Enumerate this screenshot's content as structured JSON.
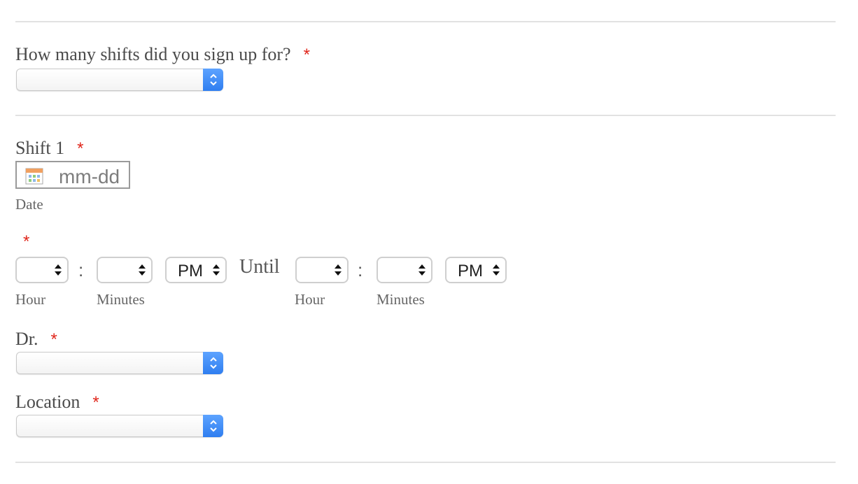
{
  "required_marker": "*",
  "shifts_question": {
    "label": "How many shifts did you sign up for?",
    "value": ""
  },
  "shift1": {
    "label": "Shift 1",
    "date_placeholder": "mm-dd",
    "date_sublabel": "Date",
    "time": {
      "start_hour": "",
      "start_minutes": "",
      "start_ampm": "PM",
      "separator": ":",
      "until_label": "Until",
      "end_hour": "",
      "end_minutes": "",
      "end_ampm": "PM",
      "hour_label": "Hour",
      "minutes_label": "Minutes"
    }
  },
  "doctor": {
    "label": "Dr.",
    "value": ""
  },
  "location": {
    "label": "Location",
    "value": ""
  },
  "icons": {
    "calendar": "calendar-icon",
    "stepper": "updown-chevron-icon",
    "select_arrows": "sort-arrows-icon"
  },
  "colors": {
    "required": "#e0261b",
    "stepper_blue": "#3b86f5",
    "divider": "#e2e2e2"
  }
}
